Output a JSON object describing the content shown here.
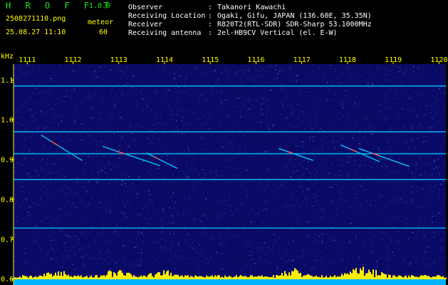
{
  "app": {
    "title": "H R O F F T",
    "version": "1.0.0",
    "filename": "2508271110.png",
    "datetime": "25.08.27 11:10",
    "meteor_label": "meteor",
    "meteor_count": "60"
  },
  "info": [
    {
      "label": "Observer",
      "sep": ":",
      "value": "Takanori Kawachi"
    },
    {
      "label": "Receiving Location",
      "sep": ":",
      "value": "Ogaki, Gifu, JAPAN (136.60E, 35.35N)"
    },
    {
      "label": "Receiver",
      "sep": ":",
      "value": "R820T2(RTL-SDR) SDR-Sharp 53.1000MHz"
    },
    {
      "label": "Receiving antenna",
      "sep": ":",
      "value": "2el-HB9CV Vertical (el. E-W)"
    }
  ],
  "chart_data": {
    "type": "heatmap",
    "y_unit": "kHz",
    "x_ticks": [
      "1111",
      "1112",
      "1113",
      "1114",
      "1115",
      "1116",
      "1117",
      "1118",
      "1119",
      "1120"
    ],
    "y_ticks": [
      "1.1",
      "1.0",
      "0.9",
      "0.8",
      "0.7",
      "0.6"
    ],
    "ylim": [
      0.585,
      1.14
    ],
    "x_range": [
      1110.7,
      1120.15
    ],
    "constant_lines_khz": [
      1.085,
      0.97,
      0.915,
      0.85,
      0.728
    ],
    "meteor_echoes": [
      {
        "t0": 1111.3,
        "f0": 0.962,
        "t1": 1112.2,
        "f1": 0.898
      },
      {
        "t0": 1112.65,
        "f0": 0.933,
        "t1": 1113.9,
        "f1": 0.885
      },
      {
        "t0": 1113.6,
        "f0": 0.917,
        "t1": 1114.28,
        "f1": 0.878
      },
      {
        "t0": 1116.5,
        "f0": 0.928,
        "t1": 1117.25,
        "f1": 0.898
      },
      {
        "t0": 1117.85,
        "f0": 0.937,
        "t1": 1118.7,
        "f1": 0.895
      },
      {
        "t0": 1118.25,
        "f0": 0.928,
        "t1": 1119.35,
        "f1": 0.883
      }
    ],
    "colors": {
      "background": "#0a0a66",
      "noise": "#3a4ab8",
      "line": "#00c8ff",
      "echo_core": "#ff5050",
      "level": "#ffee00",
      "text": "#ffff00"
    }
  }
}
